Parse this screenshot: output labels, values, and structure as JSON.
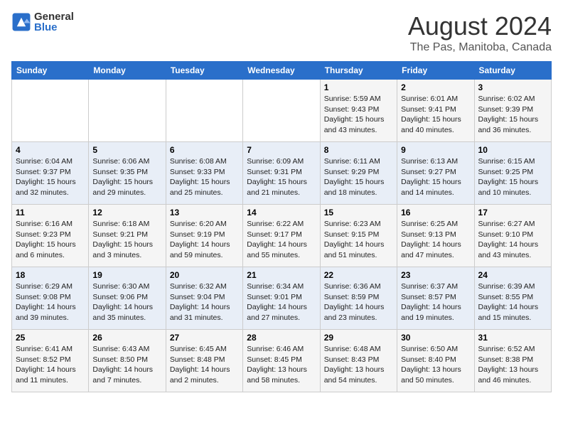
{
  "header": {
    "logo_general": "General",
    "logo_blue": "Blue",
    "title": "August 2024",
    "subtitle": "The Pas, Manitoba, Canada"
  },
  "weekdays": [
    "Sunday",
    "Monday",
    "Tuesday",
    "Wednesday",
    "Thursday",
    "Friday",
    "Saturday"
  ],
  "weeks": [
    [
      {
        "day": "",
        "info": ""
      },
      {
        "day": "",
        "info": ""
      },
      {
        "day": "",
        "info": ""
      },
      {
        "day": "",
        "info": ""
      },
      {
        "day": "1",
        "info": "Sunrise: 5:59 AM\nSunset: 9:43 PM\nDaylight: 15 hours\nand 43 minutes."
      },
      {
        "day": "2",
        "info": "Sunrise: 6:01 AM\nSunset: 9:41 PM\nDaylight: 15 hours\nand 40 minutes."
      },
      {
        "day": "3",
        "info": "Sunrise: 6:02 AM\nSunset: 9:39 PM\nDaylight: 15 hours\nand 36 minutes."
      }
    ],
    [
      {
        "day": "4",
        "info": "Sunrise: 6:04 AM\nSunset: 9:37 PM\nDaylight: 15 hours\nand 32 minutes."
      },
      {
        "day": "5",
        "info": "Sunrise: 6:06 AM\nSunset: 9:35 PM\nDaylight: 15 hours\nand 29 minutes."
      },
      {
        "day": "6",
        "info": "Sunrise: 6:08 AM\nSunset: 9:33 PM\nDaylight: 15 hours\nand 25 minutes."
      },
      {
        "day": "7",
        "info": "Sunrise: 6:09 AM\nSunset: 9:31 PM\nDaylight: 15 hours\nand 21 minutes."
      },
      {
        "day": "8",
        "info": "Sunrise: 6:11 AM\nSunset: 9:29 PM\nDaylight: 15 hours\nand 18 minutes."
      },
      {
        "day": "9",
        "info": "Sunrise: 6:13 AM\nSunset: 9:27 PM\nDaylight: 15 hours\nand 14 minutes."
      },
      {
        "day": "10",
        "info": "Sunrise: 6:15 AM\nSunset: 9:25 PM\nDaylight: 15 hours\nand 10 minutes."
      }
    ],
    [
      {
        "day": "11",
        "info": "Sunrise: 6:16 AM\nSunset: 9:23 PM\nDaylight: 15 hours\nand 6 minutes."
      },
      {
        "day": "12",
        "info": "Sunrise: 6:18 AM\nSunset: 9:21 PM\nDaylight: 15 hours\nand 3 minutes."
      },
      {
        "day": "13",
        "info": "Sunrise: 6:20 AM\nSunset: 9:19 PM\nDaylight: 14 hours\nand 59 minutes."
      },
      {
        "day": "14",
        "info": "Sunrise: 6:22 AM\nSunset: 9:17 PM\nDaylight: 14 hours\nand 55 minutes."
      },
      {
        "day": "15",
        "info": "Sunrise: 6:23 AM\nSunset: 9:15 PM\nDaylight: 14 hours\nand 51 minutes."
      },
      {
        "day": "16",
        "info": "Sunrise: 6:25 AM\nSunset: 9:13 PM\nDaylight: 14 hours\nand 47 minutes."
      },
      {
        "day": "17",
        "info": "Sunrise: 6:27 AM\nSunset: 9:10 PM\nDaylight: 14 hours\nand 43 minutes."
      }
    ],
    [
      {
        "day": "18",
        "info": "Sunrise: 6:29 AM\nSunset: 9:08 PM\nDaylight: 14 hours\nand 39 minutes."
      },
      {
        "day": "19",
        "info": "Sunrise: 6:30 AM\nSunset: 9:06 PM\nDaylight: 14 hours\nand 35 minutes."
      },
      {
        "day": "20",
        "info": "Sunrise: 6:32 AM\nSunset: 9:04 PM\nDaylight: 14 hours\nand 31 minutes."
      },
      {
        "day": "21",
        "info": "Sunrise: 6:34 AM\nSunset: 9:01 PM\nDaylight: 14 hours\nand 27 minutes."
      },
      {
        "day": "22",
        "info": "Sunrise: 6:36 AM\nSunset: 8:59 PM\nDaylight: 14 hours\nand 23 minutes."
      },
      {
        "day": "23",
        "info": "Sunrise: 6:37 AM\nSunset: 8:57 PM\nDaylight: 14 hours\nand 19 minutes."
      },
      {
        "day": "24",
        "info": "Sunrise: 6:39 AM\nSunset: 8:55 PM\nDaylight: 14 hours\nand 15 minutes."
      }
    ],
    [
      {
        "day": "25",
        "info": "Sunrise: 6:41 AM\nSunset: 8:52 PM\nDaylight: 14 hours\nand 11 minutes."
      },
      {
        "day": "26",
        "info": "Sunrise: 6:43 AM\nSunset: 8:50 PM\nDaylight: 14 hours\nand 7 minutes."
      },
      {
        "day": "27",
        "info": "Sunrise: 6:45 AM\nSunset: 8:48 PM\nDaylight: 14 hours\nand 2 minutes."
      },
      {
        "day": "28",
        "info": "Sunrise: 6:46 AM\nSunset: 8:45 PM\nDaylight: 13 hours\nand 58 minutes."
      },
      {
        "day": "29",
        "info": "Sunrise: 6:48 AM\nSunset: 8:43 PM\nDaylight: 13 hours\nand 54 minutes."
      },
      {
        "day": "30",
        "info": "Sunrise: 6:50 AM\nSunset: 8:40 PM\nDaylight: 13 hours\nand 50 minutes."
      },
      {
        "day": "31",
        "info": "Sunrise: 6:52 AM\nSunset: 8:38 PM\nDaylight: 13 hours\nand 46 minutes."
      }
    ]
  ]
}
